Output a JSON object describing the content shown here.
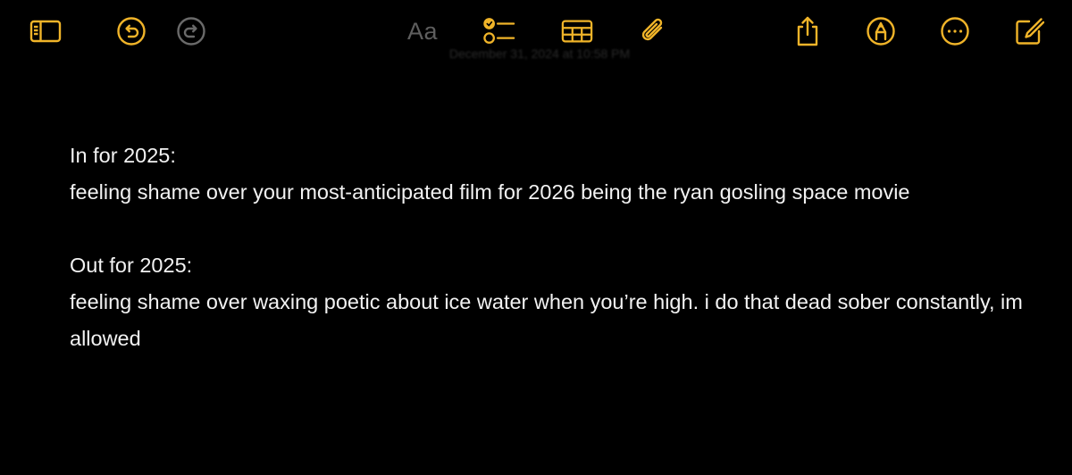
{
  "toolbar": {
    "format_label": "Aa",
    "accent_color": "#f0b429",
    "icons": {
      "sidebar": "sidebar-icon",
      "undo": "undo-icon",
      "redo": "redo-icon",
      "format": "format-text-icon",
      "checklist": "checklist-icon",
      "table": "table-icon",
      "attachment": "paperclip-icon",
      "share": "share-icon",
      "markup": "markup-pen-icon",
      "more": "more-ellipsis-icon",
      "compose": "compose-icon"
    }
  },
  "note": {
    "date_line": "December 31, 2024 at 10:58 PM",
    "lines": [
      "In for 2025:",
      "feeling shame over your most-anticipated film for 2026 being the ryan gosling space movie",
      "",
      "Out for 2025:",
      "feeling shame over waxing poetic about ice water when you’re high. i do that dead sober constantly, im allowed"
    ]
  }
}
